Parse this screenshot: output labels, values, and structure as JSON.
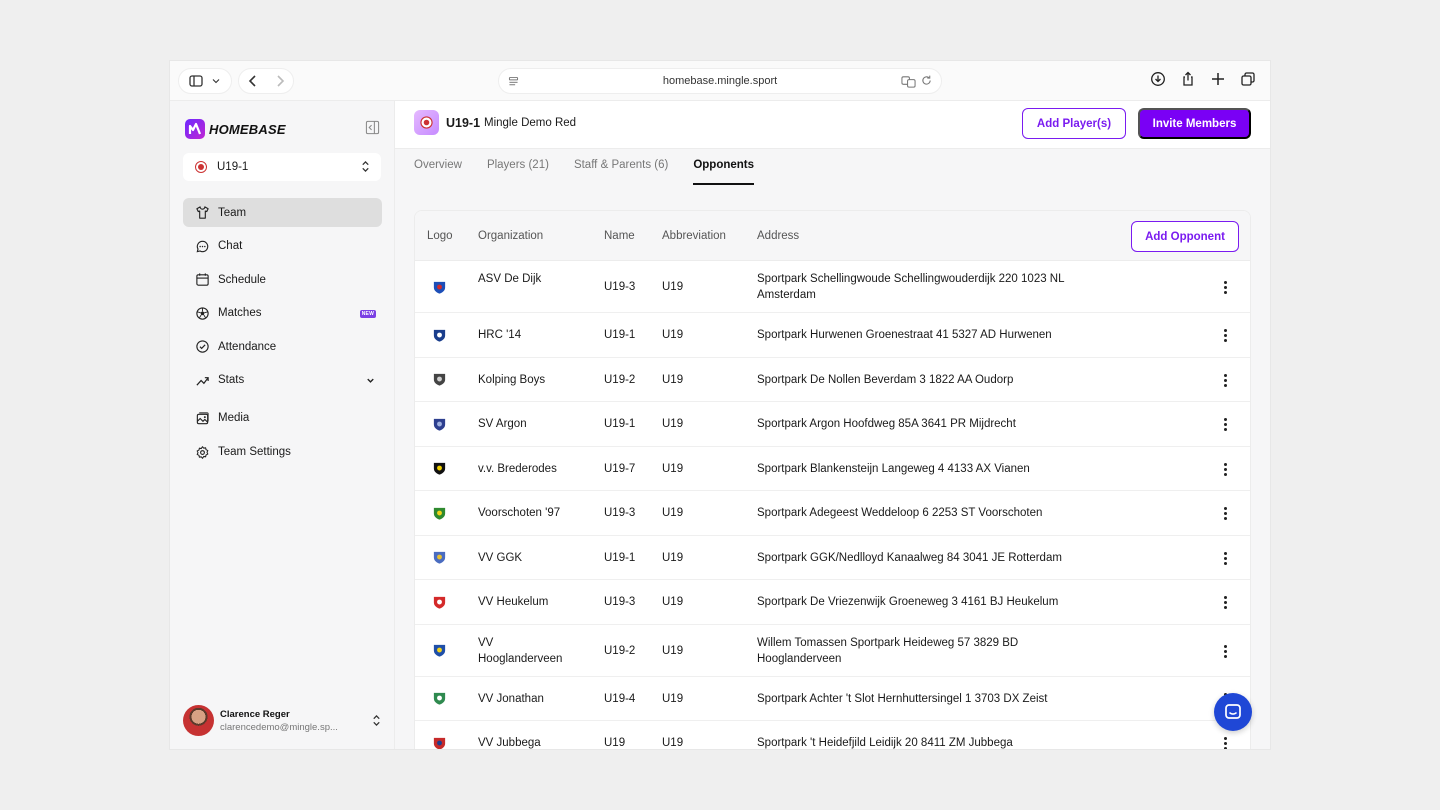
{
  "browser": {
    "url": "homebase.mingle.sport"
  },
  "sidebar": {
    "logo_text": "HOMEBASE",
    "team_selector": "U19-1",
    "items": [
      {
        "label": "Team",
        "icon": "shirt-icon",
        "active": true
      },
      {
        "label": "Chat",
        "icon": "chat-icon"
      },
      {
        "label": "Schedule",
        "icon": "calendar-icon"
      },
      {
        "label": "Matches",
        "icon": "soccer-ball-icon",
        "badge": "NEW"
      },
      {
        "label": "Attendance",
        "icon": "check-circle-icon"
      },
      {
        "label": "Stats",
        "icon": "chart-icon",
        "expandable": true
      },
      {
        "label": "Media",
        "icon": "image-icon"
      },
      {
        "label": "Team Settings",
        "icon": "gear-icon"
      }
    ],
    "user": {
      "name": "Clarence Reger",
      "email": "clarencedemo@mingle.sp..."
    }
  },
  "header": {
    "team_code": "U19-1",
    "team_name": "Mingle Demo Red",
    "add_players_label": "Add Player(s)",
    "invite_members_label": "Invite Members"
  },
  "tabs": [
    {
      "label": "Overview"
    },
    {
      "label": "Players (21)"
    },
    {
      "label": "Staff & Parents (6)"
    },
    {
      "label": "Opponents",
      "active": true
    }
  ],
  "table": {
    "columns": {
      "logo": "Logo",
      "organization": "Organization",
      "name": "Name",
      "abbreviation": "Abbreviation",
      "address": "Address"
    },
    "add_opponent_label": "Add Opponent",
    "rows": [
      {
        "organization": "ASV De Dijk",
        "name": "U19-3",
        "abbreviation": "U19",
        "address": "Sportpark Schellingwoude Schellingwouderdijk 220 1023 NL Amsterdam",
        "logo_color": "#1d4fb8",
        "logo_accent": "#d42a2a"
      },
      {
        "organization": "HRC '14",
        "name": "U19-1",
        "abbreviation": "U19",
        "address": "Sportpark Hurwenen Groenestraat 41 5327 AD Hurwenen",
        "logo_color": "#1a3e8c",
        "logo_accent": "#ffffff"
      },
      {
        "organization": "Kolping Boys",
        "name": "U19-2",
        "abbreviation": "U19",
        "address": "Sportpark De Nollen Beverdam 3 1822 AA Oudorp",
        "logo_color": "#444444",
        "logo_accent": "#d0d0d0"
      },
      {
        "organization": "SV Argon",
        "name": "U19-1",
        "abbreviation": "U19",
        "address": "Sportpark Argon Hoofdweg 85A 3641 PR Mijdrecht",
        "logo_color": "#2d3f8f",
        "logo_accent": "#9fb0e0"
      },
      {
        "organization": "v.v. Brederodes",
        "name": "U19-7",
        "abbreviation": "U19",
        "address": "Sportpark Blankensteijn Langeweg 4 4133 AX Vianen",
        "logo_color": "#111111",
        "logo_accent": "#f0d000"
      },
      {
        "organization": "Voorschoten '97",
        "name": "U19-3",
        "abbreviation": "U19",
        "address": "Sportpark Adegeest Weddeloop 6 2253 ST Voorschoten",
        "logo_color": "#2f8a2f",
        "logo_accent": "#f2d21a"
      },
      {
        "organization": "VV GGK",
        "name": "U19-1",
        "abbreviation": "U19",
        "address": "Sportpark GGK/Nedlloyd Kanaalweg 84 3041 JE Rotterdam",
        "logo_color": "#4a6cc0",
        "logo_accent": "#e8c030"
      },
      {
        "organization": "VV Heukelum",
        "name": "U19-3",
        "abbreviation": "U19",
        "address": "Sportpark De Vriezenwijk Groeneweg 3 4161 BJ Heukelum",
        "logo_color": "#d42a2a",
        "logo_accent": "#ffffff"
      },
      {
        "organization": "VV Hooglanderveen",
        "name": "U19-2",
        "abbreviation": "U19",
        "address": "Willem Tomassen Sportpark Heideweg 57 3829 BD Hooglanderveen",
        "logo_color": "#1f4fa8",
        "logo_accent": "#f2d21a"
      },
      {
        "organization": "VV Jonathan",
        "name": "U19-4",
        "abbreviation": "U19",
        "address": "Sportpark Achter 't Slot Hernhuttersingel 1 3703 DX Zeist",
        "logo_color": "#2f8a4f",
        "logo_accent": "#ffffff"
      },
      {
        "organization": "VV Jubbega",
        "name": "U19",
        "abbreviation": "U19",
        "address": "Sportpark 't Heidefjild Leidijk 20 8411 ZM Jubbega",
        "logo_color": "#c62a2a",
        "logo_accent": "#1d3f8f"
      }
    ]
  },
  "colors": {
    "accent": "#7a00f5",
    "chat_bubble": "#1f47d6"
  }
}
